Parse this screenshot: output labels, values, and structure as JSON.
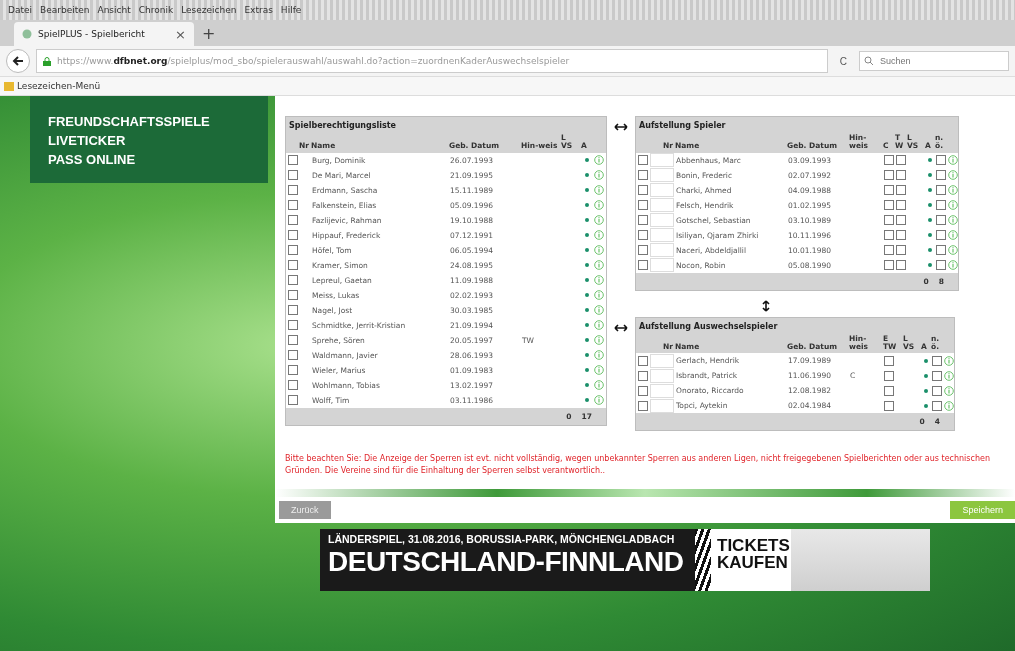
{
  "browser": {
    "menu": [
      "Datei",
      "Bearbeiten",
      "Ansicht",
      "Chronik",
      "Lesezeichen",
      "Extras",
      "Hilfe"
    ],
    "tab": {
      "title": "SpielPLUS - Spielbericht",
      "close": "×",
      "new_tab": "+"
    },
    "url": {
      "prefix": "https://www.",
      "domain": "dfbnet.org",
      "path": "/spielplus/mod_sbo/spielerauswahl/auswahl.do?action=zuordnenKaderAuswechselspieler"
    },
    "reload": "C",
    "search_placeholder": "Suchen",
    "bookmarks": [
      "Lesezeichen-Menü"
    ]
  },
  "nav": [
    "FREUNDSCHAFTSSPIELE",
    "LIVETICKER",
    "PASS ONLINE"
  ],
  "tables": [
    {
      "title": "Spielberechtigungsliste",
      "columns": [
        {
          "kind": "select",
          "label": "Nr"
        },
        {
          "kind": "name",
          "label": "Name"
        },
        {
          "kind": "date",
          "label": "Geb. Datum"
        },
        {
          "kind": "note",
          "label": "Hin-weis"
        },
        {
          "kind": "lvs",
          "label": "L VS"
        },
        {
          "kind": "dot",
          "label": "A"
        },
        {
          "kind": "info"
        }
      ],
      "rows": [
        {
          "name": "Burg, Dominik",
          "date": "26.07.1993",
          "note": "",
          "checked": false,
          "flags": []
        },
        {
          "name": "De Mari, Marcel",
          "date": "21.09.1995",
          "note": "",
          "checked": false,
          "flags": []
        },
        {
          "name": "Erdmann, Sascha",
          "date": "15.11.1989",
          "note": "",
          "checked": false,
          "flags": []
        },
        {
          "name": "Falkenstein, Elias",
          "date": "05.09.1996",
          "note": "",
          "checked": false,
          "flags": []
        },
        {
          "name": "Fazlijevic, Rahman",
          "date": "19.10.1988",
          "note": "",
          "checked": false,
          "flags": []
        },
        {
          "name": "Hippauf, Frederick",
          "date": "07.12.1991",
          "note": "",
          "checked": false,
          "flags": []
        },
        {
          "name": "Höfel, Tom",
          "date": "06.05.1994",
          "note": "",
          "checked": false,
          "flags": []
        },
        {
          "name": "Kramer, Simon",
          "date": "24.08.1995",
          "note": "",
          "checked": false,
          "flags": []
        },
        {
          "name": "Lepreul, Gaetan",
          "date": "11.09.1988",
          "note": "",
          "checked": false,
          "flags": []
        },
        {
          "name": "Meiss, Lukas",
          "date": "02.02.1993",
          "note": "",
          "checked": false,
          "flags": []
        },
        {
          "name": "Nagel, Jost",
          "date": "30.03.1985",
          "note": "",
          "checked": false,
          "flags": []
        },
        {
          "name": "Schmidtke, Jerrit-Kristian",
          "date": "21.09.1994",
          "note": "",
          "checked": false,
          "flags": []
        },
        {
          "name": "Sprehe, Sören",
          "date": "20.05.1997",
          "note": "TW",
          "checked": false,
          "flags": []
        },
        {
          "name": "Waldmann, Javier",
          "date": "28.06.1993",
          "note": "",
          "checked": false,
          "flags": []
        },
        {
          "name": "Wieler, Marius",
          "date": "01.09.1983",
          "note": "",
          "checked": false,
          "flags": []
        },
        {
          "name": "Wohlmann, Tobias",
          "date": "13.02.1997",
          "note": "",
          "checked": false,
          "flags": []
        },
        {
          "name": "Wolff, Tim",
          "date": "03.11.1986",
          "note": "",
          "checked": false,
          "flags": []
        }
      ],
      "footer": [
        "0",
        "17"
      ]
    },
    {
      "title": "Aufstellung Spieler",
      "columns": [
        {
          "kind": "select_nr",
          "label": "Nr"
        },
        {
          "kind": "name",
          "label": "Name"
        },
        {
          "kind": "date",
          "label": "Geb. Datum"
        },
        {
          "kind": "note",
          "label": "Hin-weis"
        },
        {
          "kind": "flag",
          "label": "C"
        },
        {
          "kind": "flag",
          "label": "T W"
        },
        {
          "kind": "lvs",
          "label": "L VS"
        },
        {
          "kind": "dot",
          "label": "A"
        },
        {
          "kind": "flag",
          "label": "n. ö."
        },
        {
          "kind": "info"
        }
      ],
      "rows": [
        {
          "name": "Abbenhaus, Marc",
          "date": "03.09.1993",
          "note": "",
          "checked": false,
          "flags": [
            false,
            false,
            false
          ]
        },
        {
          "name": "Bonin, Frederic",
          "date": "02.07.1992",
          "note": "",
          "checked": false,
          "flags": [
            false,
            false,
            false
          ]
        },
        {
          "name": "Charki, Ahmed",
          "date": "04.09.1988",
          "note": "",
          "checked": false,
          "flags": [
            false,
            false,
            false
          ]
        },
        {
          "name": "Felsch, Hendrik",
          "date": "01.02.1995",
          "note": "",
          "checked": false,
          "flags": [
            false,
            false,
            false
          ]
        },
        {
          "name": "Gotschel, Sebastian",
          "date": "03.10.1989",
          "note": "",
          "checked": false,
          "flags": [
            false,
            false,
            false
          ]
        },
        {
          "name": "Isiliyan, Qjaram Zhirki",
          "date": "10.11.1996",
          "note": "",
          "checked": false,
          "flags": [
            false,
            false,
            false
          ]
        },
        {
          "name": "Naceri, Abdeldjallil",
          "date": "10.01.1980",
          "note": "",
          "checked": false,
          "flags": [
            false,
            false,
            false
          ]
        },
        {
          "name": "Nocon, Robin",
          "date": "05.08.1990",
          "note": "",
          "checked": false,
          "flags": [
            false,
            false,
            false
          ]
        }
      ],
      "footer": [
        "0",
        "8"
      ]
    },
    {
      "title": "Aufstellung Auswechselspieler",
      "columns": [
        {
          "kind": "select_nr",
          "label": "Nr"
        },
        {
          "kind": "name",
          "label": "Name"
        },
        {
          "kind": "date",
          "label": "Geb. Datum"
        },
        {
          "kind": "note",
          "label": "Hin-weis"
        },
        {
          "kind": "flagw",
          "label": "E TW"
        },
        {
          "kind": "lvs",
          "label": "L VS"
        },
        {
          "kind": "dot",
          "label": "A"
        },
        {
          "kind": "flag",
          "label": "n. ö."
        },
        {
          "kind": "info"
        }
      ],
      "rows": [
        {
          "name": "Gerlach, Hendrik",
          "date": "17.09.1989",
          "note": "",
          "checked": false,
          "flags": [
            false,
            false
          ]
        },
        {
          "name": "Isbrandt, Patrick",
          "date": "11.06.1990",
          "note": "C",
          "checked": false,
          "flags": [
            false,
            false
          ]
        },
        {
          "name": "Onorato, Riccardo",
          "date": "12.08.1982",
          "note": "",
          "checked": false,
          "flags": [
            false,
            false
          ]
        },
        {
          "name": "Topci, Aytekin",
          "date": "02.04.1984",
          "note": "",
          "checked": false,
          "flags": [
            false,
            false
          ]
        }
      ],
      "footer": [
        "0",
        "4"
      ]
    }
  ],
  "notice": "Bitte beachten Sie: Die Anzeige der Sperren ist evt. nicht vollständig, wegen unbekannter Sperren aus anderen Ligen, nicht freigegebenen Spielberichten oder aus technischen Gründen. Die Vereine sind für die Einhaltung der Sperren selbst verantwortlich..",
  "buttons": {
    "back": "Zurück",
    "save": "Speichern"
  },
  "banner": {
    "line1": "LÄNDERSPIEL, 31.08.2016, BORUSSIA-PARK, MÖNCHENGLADBACH",
    "line2": "DEUTSCHLAND-FINNLAND",
    "cta": "TICKETS KAUFEN"
  }
}
